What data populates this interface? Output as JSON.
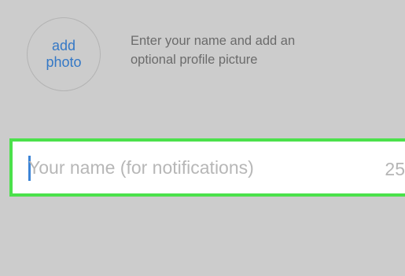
{
  "profile": {
    "add_photo_line1": "add",
    "add_photo_line2": "photo",
    "instruction_line1": "Enter your name and add an",
    "instruction_line2": "optional profile picture"
  },
  "name_field": {
    "placeholder": "Your name (for notifications)",
    "value": "",
    "char_count": "25"
  },
  "colors": {
    "background": "#cccccc",
    "link_blue": "#3478c6",
    "highlight_green": "#4be14b",
    "cursor_blue": "#3c84d6"
  }
}
